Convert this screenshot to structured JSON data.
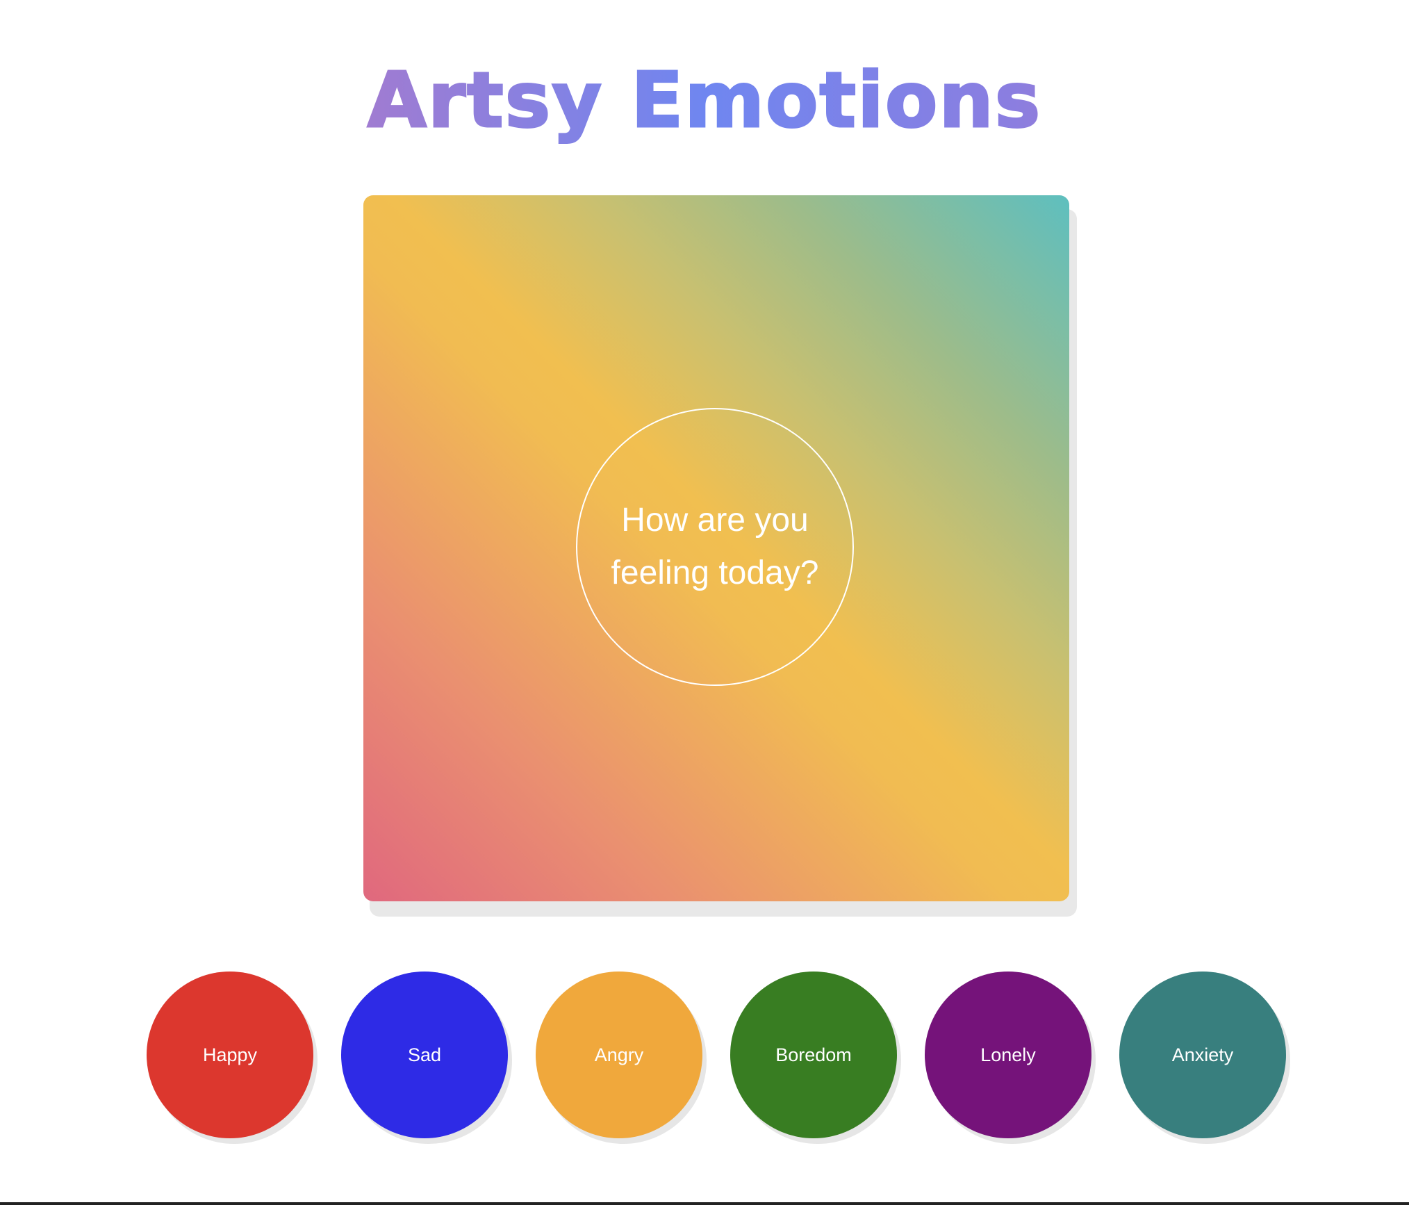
{
  "header": {
    "title": "Artsy Emotions"
  },
  "canvas": {
    "prompt": "How are you feeling today?",
    "gradient_colors": [
      "#e0687e",
      "#f1bc52",
      "#5ebfbf"
    ]
  },
  "emotions": [
    {
      "label": "Happy",
      "color": "#dc372e"
    },
    {
      "label": "Sad",
      "color": "#2e2be6"
    },
    {
      "label": "Angry",
      "color": "#f0a83c"
    },
    {
      "label": "Boredom",
      "color": "#387d22"
    },
    {
      "label": "Lonely",
      "color": "#75137a"
    },
    {
      "label": "Anxiety",
      "color": "#387f7e"
    }
  ]
}
